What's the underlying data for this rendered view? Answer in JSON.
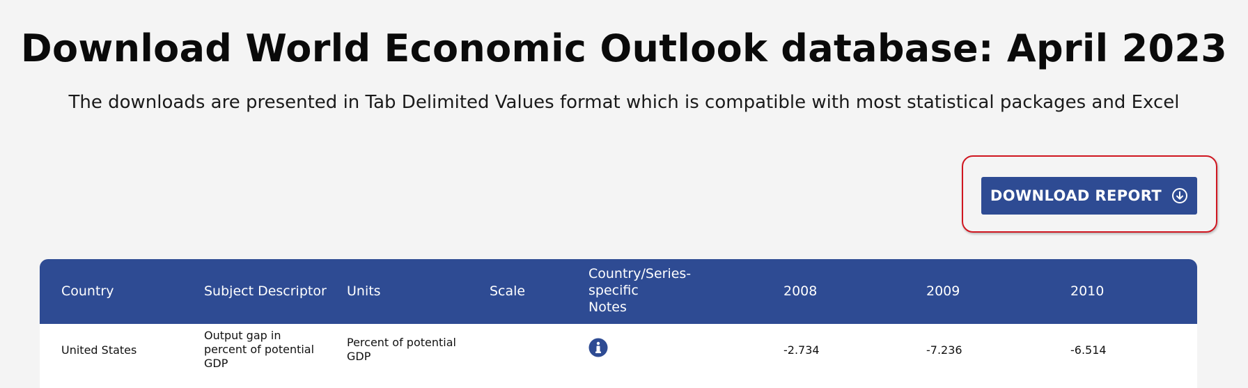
{
  "header": {
    "title": "Download World Economic Outlook database: April 2023",
    "subtitle": "The downloads are presented in Tab Delimited Values format which is compatible with most statistical packages and Excel"
  },
  "actions": {
    "download_label": "DOWNLOAD REPORT",
    "download_icon": "download-circle-icon"
  },
  "table": {
    "columns": [
      "Country",
      "Subject Descriptor",
      "Units",
      "Scale",
      "Country/Series-specific Notes",
      "2008",
      "2009",
      "2010"
    ],
    "header_notes_lines": [
      "Country/Series-",
      "specific",
      "Notes"
    ],
    "rows": [
      {
        "country": "United States",
        "subject_lines": [
          "Output gap in",
          "percent of potential",
          "GDP"
        ],
        "units_lines": [
          "Percent of potential",
          "GDP"
        ],
        "scale": "",
        "notes_icon": "info-icon",
        "y2008": "-2.734",
        "y2009": "-7.236",
        "y2010": "-6.514"
      }
    ]
  },
  "colors": {
    "accent": "#2e4b93",
    "highlight": "#d01620",
    "background": "#f4f4f4"
  }
}
